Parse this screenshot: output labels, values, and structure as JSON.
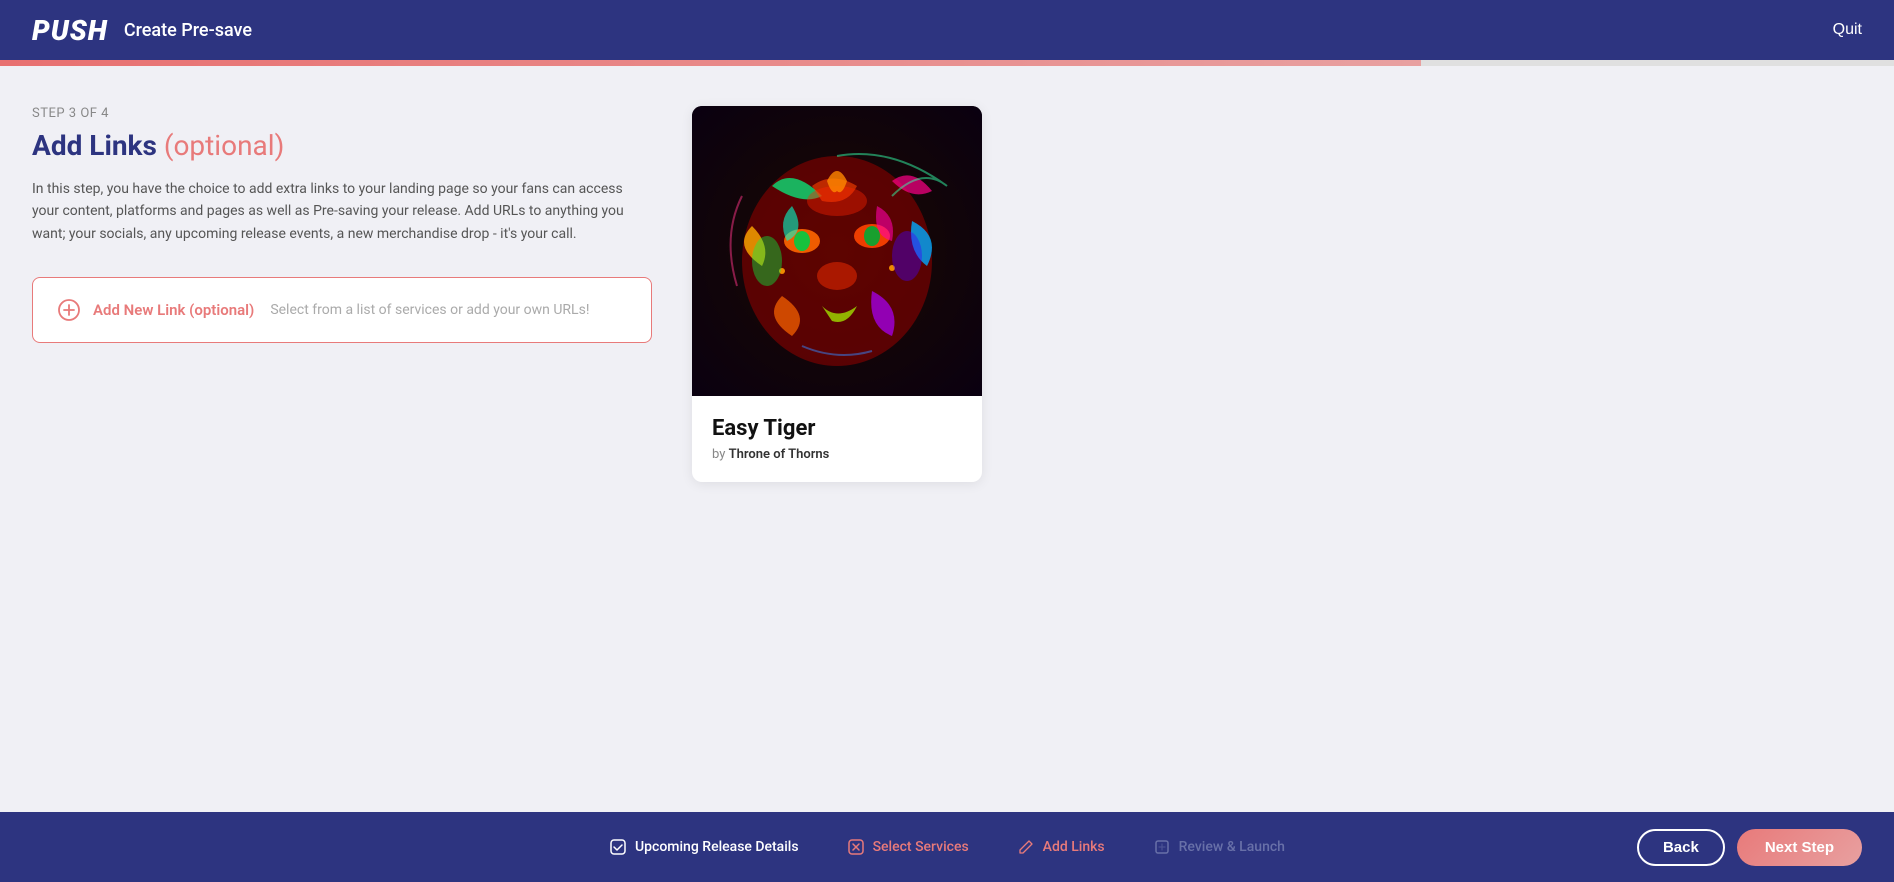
{
  "header": {
    "logo": "PUSH",
    "title": "Create Pre-save",
    "quit_label": "Quit"
  },
  "progress": {
    "percent": 75,
    "current_step": 3,
    "total_steps": 4,
    "step_label": "STEP 3 OF 4"
  },
  "page": {
    "title": "Add Links",
    "title_suffix": "(optional)",
    "description": "In this step, you have the choice to add extra links to your landing page so your fans can access your content, platforms and pages as well as Pre-saving your release. Add URLs to anything you want; your socials, any upcoming release events, a new merchandise drop - it's your call."
  },
  "add_link": {
    "label": "Add New Link (optional)",
    "hint": "Select from a list of services or add your own URLs!"
  },
  "album": {
    "title": "Easy Tiger",
    "by_label": "by",
    "artist": "Throne of Thorns"
  },
  "footer": {
    "steps": [
      {
        "id": "upcoming-release-details",
        "label": "Upcoming Release Details",
        "state": "completed",
        "icon": "✓"
      },
      {
        "id": "select-services",
        "label": "Select Services",
        "state": "completed",
        "icon": "✕"
      },
      {
        "id": "add-links",
        "label": "Add Links",
        "state": "active",
        "icon": "✏"
      },
      {
        "id": "review-launch",
        "label": "Review & Launch",
        "state": "inactive",
        "icon": "▭"
      }
    ],
    "back_label": "Back",
    "next_label": "Next Step"
  }
}
